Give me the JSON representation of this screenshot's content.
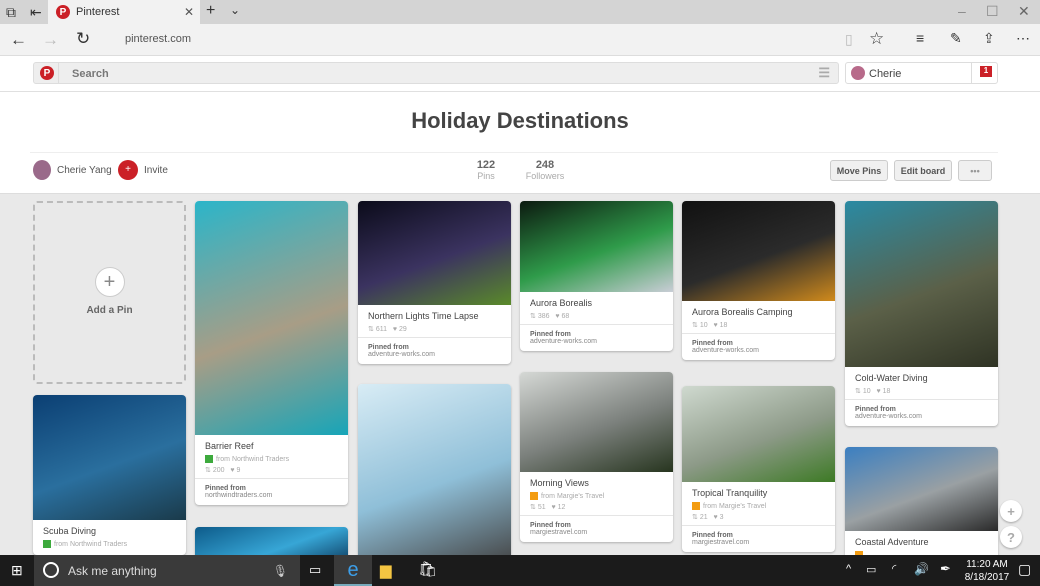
{
  "browser": {
    "tab_title": "Pinterest",
    "url": "pinterest.com"
  },
  "header": {
    "search_placeholder": "Search",
    "user_name": "Cherie",
    "notification_count": "1"
  },
  "board": {
    "title": "Holiday Destinations",
    "owner": "Cherie Yang",
    "invite": "Invite",
    "pins_count": "122",
    "pins_label": "Pins",
    "followers_count": "248",
    "followers_label": "Followers",
    "move_pins": "Move Pins",
    "edit_board": "Edit board",
    "more": "•••"
  },
  "add_pin": "Add a Pin",
  "pins": [
    {
      "title": "Scuba Diving",
      "source": "from Northwind Traders",
      "source_color": "#3daa3d",
      "colors": [
        "#0b3f73",
        "#2a6f9e",
        "#1a3a4a"
      ]
    },
    {
      "title": "Barrier Reef",
      "source": "from Northwind Traders",
      "source_color": "#3daa3d",
      "repins": "200",
      "likes": "9",
      "pinned_from": "Pinned from",
      "domain": "northwindtraders.com",
      "colors": [
        "#2bb5c9",
        "#a89d86",
        "#17a5b8"
      ]
    },
    {
      "title": "",
      "colors": [
        "#0d5b8a",
        "#37a6d6",
        "#0a3356"
      ]
    },
    {
      "title": "Northern Lights Time Lapse",
      "repins": "611",
      "likes": "29",
      "pinned_from": "Pinned from",
      "domain": "adventure-works.com",
      "colors": [
        "#0b0b1a",
        "#3b3360",
        "#5a8a2a"
      ]
    },
    {
      "title": "",
      "colors": [
        "#d8ecf5",
        "#8fbfd8",
        "#444"
      ]
    },
    {
      "title": "Aurora Borealis",
      "repins": "386",
      "likes": "68",
      "pinned_from": "Pinned from",
      "domain": "adventure-works.com",
      "colors": [
        "#0c1a10",
        "#2f9b4a",
        "#c9cdd6"
      ]
    },
    {
      "title": "Morning Views",
      "source": "from Margie's Travel",
      "source_color": "#f39c12",
      "repins": "51",
      "likes": "12",
      "pinned_from": "Pinned from",
      "domain": "margiestravel.com",
      "colors": [
        "#d5d8d5",
        "#7b807c",
        "#27351f"
      ]
    },
    {
      "title": "Aurora Borealis Camping",
      "repins": "10",
      "likes": "18",
      "pinned_from": "Pinned from",
      "domain": "adventure-works.com",
      "colors": [
        "#111",
        "#2b2b2b",
        "#d08a1c"
      ]
    },
    {
      "title": "Tropical Tranquility",
      "source": "from Margie's Travel",
      "source_color": "#f39c12",
      "repins": "21",
      "likes": "3",
      "pinned_from": "Pinned from",
      "domain": "margiestravel.com",
      "colors": [
        "#cfd9cf",
        "#8d9a88",
        "#3d7a25"
      ]
    },
    {
      "title": "Cold-Water Diving",
      "repins": "10",
      "likes": "18",
      "pinned_from": "Pinned from",
      "domain": "adventure-works.com",
      "colors": [
        "#2a8aa3",
        "#5b6048",
        "#2f3324"
      ]
    },
    {
      "title": "Coastal Adventure",
      "source": "",
      "source_color": "#f39c12",
      "colors": [
        "#3b7fc1",
        "#9aa0a3",
        "#2a2a2a"
      ]
    }
  ],
  "taskbar": {
    "search": "Ask me anything",
    "time": "11:20 AM",
    "date": "8/18/2017"
  }
}
